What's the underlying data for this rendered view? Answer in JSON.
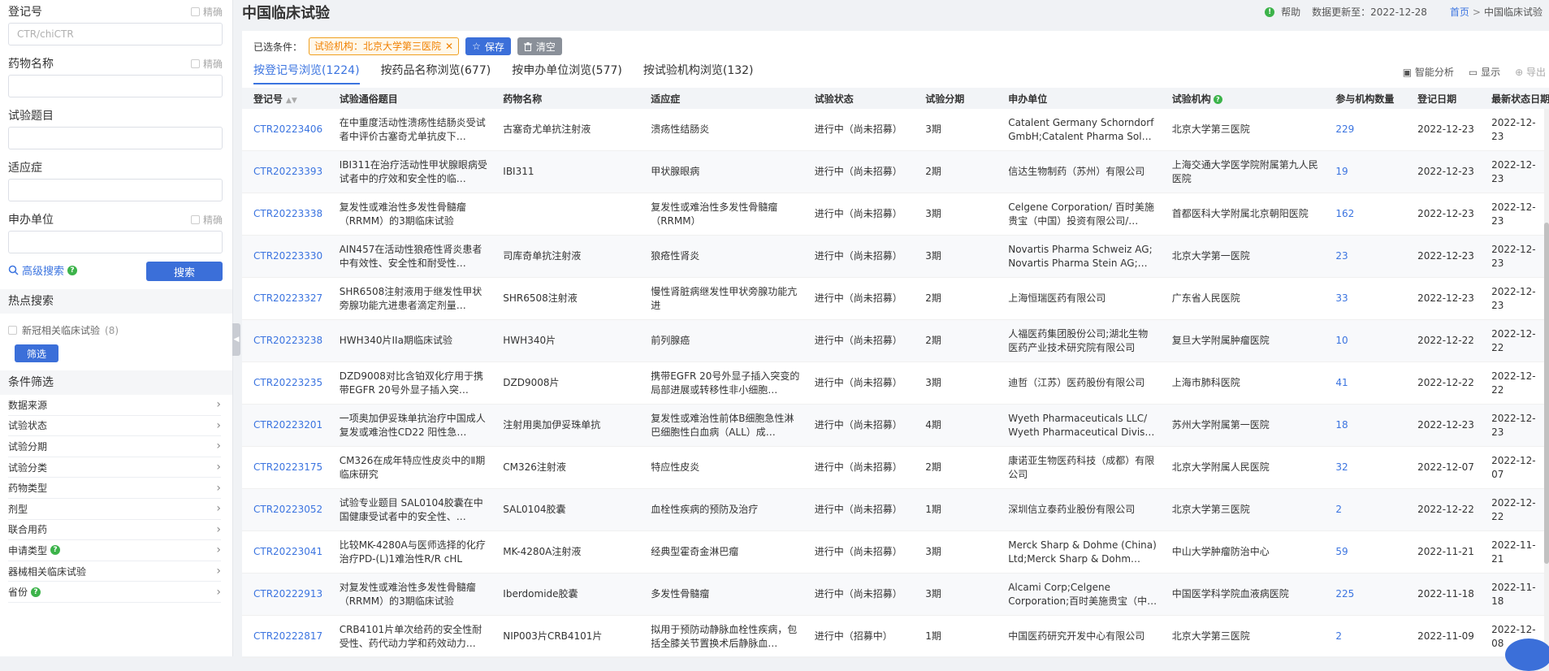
{
  "sidebar": {
    "reg_no": {
      "label": "登记号",
      "precise": "精确",
      "placeholder": "CTR/chiCTR"
    },
    "drug_name": {
      "label": "药物名称",
      "precise": "精确",
      "placeholder": ""
    },
    "title": {
      "label": "试验题目",
      "placeholder": ""
    },
    "indication": {
      "label": "适应症",
      "placeholder": ""
    },
    "sponsor": {
      "label": "申办单位",
      "precise": "精确",
      "placeholder": ""
    },
    "advanced_search": "高级搜索",
    "search_button": "搜索",
    "hot_title": "热点搜索",
    "hot_item": {
      "label": "新冠相关临床试验",
      "count": "(8)"
    },
    "filter_button": "筛选",
    "cond_title": "条件筛选",
    "conditions": [
      {
        "label": "数据来源",
        "help": false
      },
      {
        "label": "试验状态",
        "help": false
      },
      {
        "label": "试验分期",
        "help": false
      },
      {
        "label": "试验分类",
        "help": false
      },
      {
        "label": "药物类型",
        "help": false
      },
      {
        "label": "剂型",
        "help": false
      },
      {
        "label": "联合用药",
        "help": false
      },
      {
        "label": "申请类型",
        "help": true
      },
      {
        "label": "器械相关临床试验",
        "help": false
      },
      {
        "label": "省份",
        "help": true
      }
    ]
  },
  "header": {
    "title": "中国临床试验",
    "help": "帮助",
    "updated": "数据更新至：2022-12-28",
    "breadcrumb_home": "首页",
    "breadcrumb_sep": ">",
    "breadcrumb_current": "中国临床试验"
  },
  "filters": {
    "label": "已选条件：",
    "chip": "试验机构：北京大学第三医院",
    "save": "保存",
    "clear": "清空"
  },
  "tabs": [
    {
      "label": "按登记号浏览(1224)",
      "active": true
    },
    {
      "label": "按药品名称浏览(677)",
      "active": false
    },
    {
      "label": "按申办单位浏览(577)",
      "active": false
    },
    {
      "label": "按试验机构浏览(132)",
      "active": false
    }
  ],
  "tools": {
    "analysis": "智能分析",
    "display": "显示",
    "export": "导出"
  },
  "table": {
    "columns": [
      "登记号",
      "试验通俗题目",
      "药物名称",
      "适应症",
      "试验状态",
      "试验分期",
      "申办单位",
      "试验机构",
      "参与机构数量",
      "登记日期",
      "最新状态日期"
    ],
    "rows": [
      [
        "CTR20223406",
        "在中重度活动性溃疡性结肠炎受试者中评价古塞奇尤单抗皮下…",
        "古塞奇尤单抗注射液",
        "溃疡性结肠炎",
        "进行中（尚未招募）",
        "3期",
        "Catalent Germany Schorndorf GmbH;Catalent Pharma Sol…",
        "北京大学第三医院",
        "229",
        "2022-12-23",
        "2022-12-23"
      ],
      [
        "CTR20223393",
        "IBI311在治疗活动性甲状腺眼病受试者中的疗效和安全性的临…",
        "IBI311",
        "甲状腺眼病",
        "进行中（尚未招募）",
        "2期",
        "信达生物制药（苏州）有限公司",
        "上海交通大学医学院附属第九人民医院",
        "19",
        "2022-12-23",
        "2022-12-23"
      ],
      [
        "CTR20223338",
        "复发性或难治性多发性骨髓瘤（RRMM）的3期临床试验",
        "",
        "复发性或难治性多发性骨髓瘤（RRMM）",
        "进行中（尚未招募）",
        "3期",
        "Celgene Corporation/ 百时美施贵宝（中国）投资有限公司/…",
        "首都医科大学附属北京朝阳医院",
        "162",
        "2022-12-23",
        "2022-12-23"
      ],
      [
        "CTR20223330",
        "AIN457在活动性狼疮性肾炎患者中有效性、安全性和耐受性…",
        "司库奇单抗注射液",
        "狼疮性肾炎",
        "进行中（尚未招募）",
        "3期",
        "Novartis Pharma Schweiz AG; Novartis Pharma Stein AG;…",
        "北京大学第一医院",
        "23",
        "2022-12-23",
        "2022-12-23"
      ],
      [
        "CTR20223327",
        "SHR6508注射液用于继发性甲状旁腺功能亢进患者滴定剂量…",
        "SHR6508注射液",
        "慢性肾脏病继发性甲状旁腺功能亢进",
        "进行中（尚未招募）",
        "2期",
        "上海恒瑞医药有限公司",
        "广东省人民医院",
        "33",
        "2022-12-23",
        "2022-12-23"
      ],
      [
        "CTR20223238",
        "HWH340片IIa期临床试验",
        "HWH340片",
        "前列腺癌",
        "进行中（尚未招募）",
        "2期",
        "人福医药集团股份公司;湖北生物医药产业技术研究院有限公司",
        "复旦大学附属肿瘤医院",
        "10",
        "2022-12-22",
        "2022-12-22"
      ],
      [
        "CTR20223235",
        "DZD9008对比含铂双化疗用于携带EGFR 20号外显子插入突…",
        "DZD9008片",
        "携带EGFR 20号外显子插入突变的局部进展或转移性非小细胞…",
        "进行中（尚未招募）",
        "3期",
        "迪哲（江苏）医药股份有限公司",
        "上海市肺科医院",
        "41",
        "2022-12-22",
        "2022-12-22"
      ],
      [
        "CTR20223201",
        "一项奥加伊妥珠单抗治疗中国成人复发或难治性CD22 阳性急…",
        "注射用奥加伊妥珠单抗",
        "复发性或难治性前体B细胞急性淋巴细胞性白血病（ALL）成…",
        "进行中（尚未招募）",
        "4期",
        "Wyeth Pharmaceuticals LLC/ Wyeth Pharmaceutical Divis…",
        "苏州大学附属第一医院",
        "18",
        "2022-12-23",
        "2022-12-23"
      ],
      [
        "CTR20223175",
        "CM326在成年特应性皮炎中的Ⅱ期临床研究",
        "CM326注射液",
        "特应性皮炎",
        "进行中（尚未招募）",
        "2期",
        "康诺亚生物医药科技（成都）有限公司",
        "北京大学附属人民医院",
        "32",
        "2022-12-07",
        "2022-12-07"
      ],
      [
        "CTR20223052",
        "试验专业题目 SAL0104胶囊在中国健康受试者中的安全性、…",
        "SAL0104胶囊",
        "血栓性疾病的预防及治疗",
        "进行中（尚未招募）",
        "1期",
        "深圳信立泰药业股份有限公司",
        "北京大学第三医院",
        "2",
        "2022-12-22",
        "2022-12-22"
      ],
      [
        "CTR20223041",
        "比较MK-4280A与医师选择的化疗治疗PD-(L)1难治性R/R cHL",
        "MK-4280A注射液",
        "经典型霍奇金淋巴瘤",
        "进行中（尚未招募）",
        "3期",
        "Merck Sharp & Dohme (China) Ltd;Merck Sharp & Dohm…",
        "中山大学肿瘤防治中心",
        "59",
        "2022-11-21",
        "2022-11-21"
      ],
      [
        "CTR20222913",
        "对复发性或难治性多发性骨髓瘤（RRMM）的3期临床试验",
        "Iberdomide胶囊",
        "多发性骨髓瘤",
        "进行中（尚未招募）",
        "3期",
        "Alcami Corp;Celgene Corporation;百时美施贵宝（中国）投…",
        "中国医学科学院血液病医院",
        "225",
        "2022-11-18",
        "2022-11-18"
      ],
      [
        "CTR20222817",
        "CRB4101片单次给药的安全性耐受性、药代动力学和药效动力…",
        "NIP003片CRB4101片",
        "拟用于预防动静脉血栓性疾病，包括全膝关节置换术后静脉血…",
        "进行中（招募中）",
        "1期",
        "中国医药研究开发中心有限公司",
        "北京大学第三医院",
        "2",
        "2022-11-09",
        "2022-12-08"
      ]
    ]
  }
}
